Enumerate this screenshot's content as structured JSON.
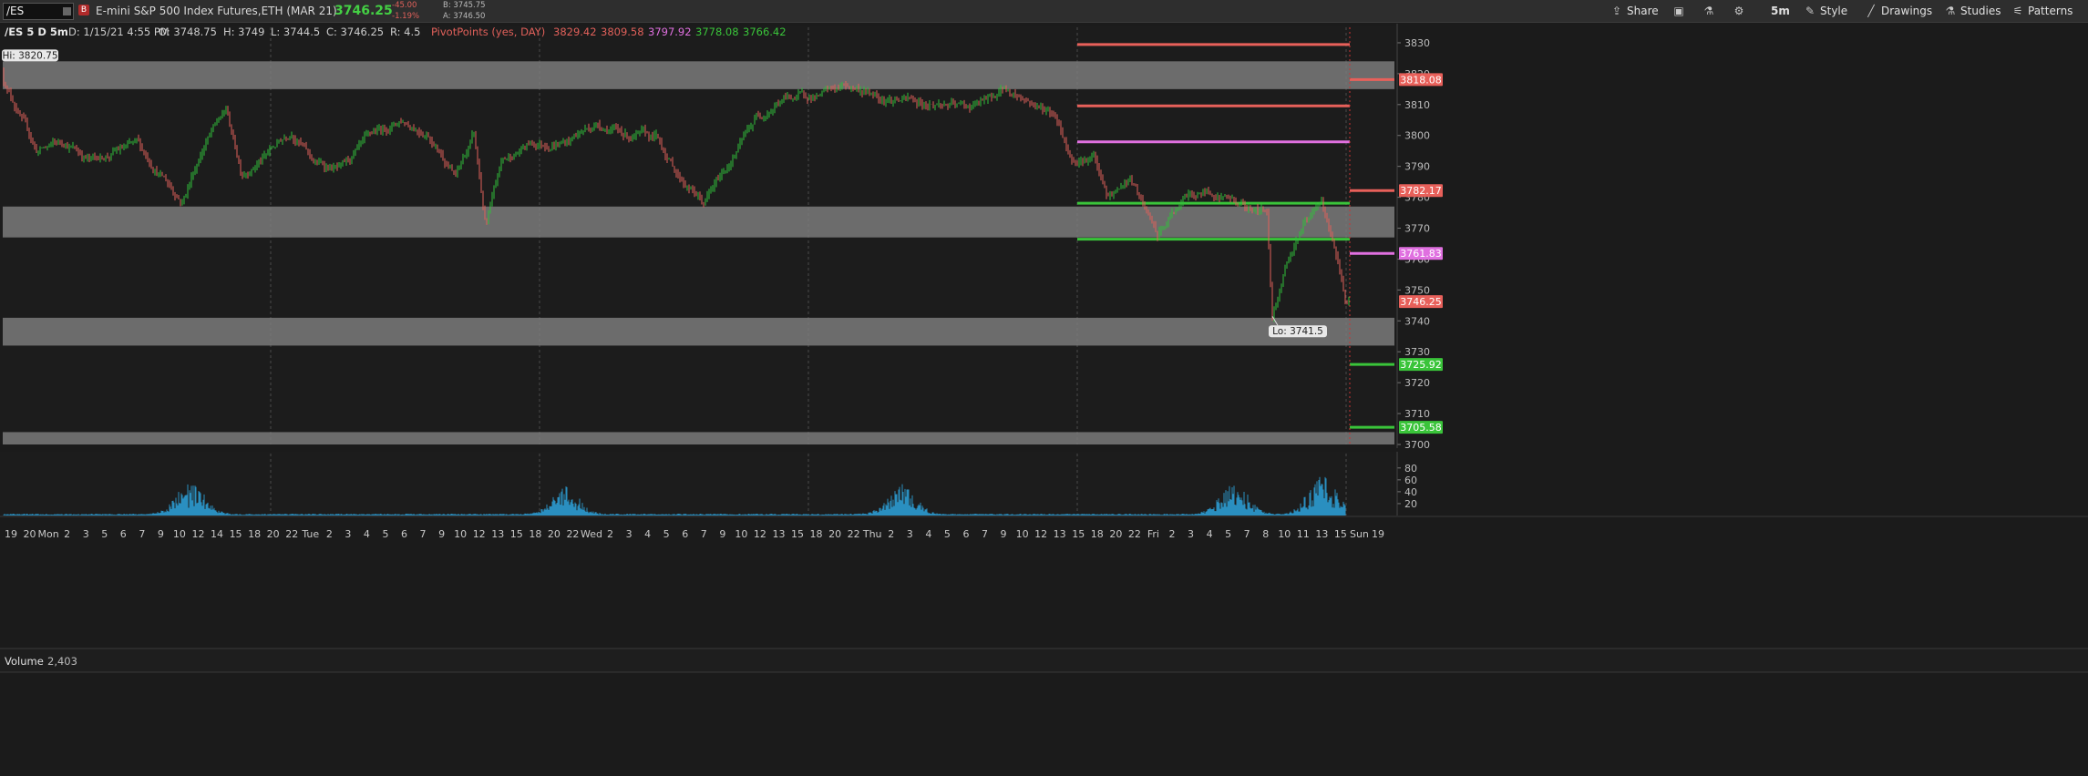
{
  "toolbar": {
    "symbol": "/ES",
    "link_badge": "B",
    "description": "E-mini S&P 500 Index Futures,ETH (MAR 21)",
    "last_price": "3746.25",
    "net_change": "-45.00",
    "pct_change": "-1.19%",
    "bid": "B: 3745.75",
    "ask": "A: 3746.50",
    "share_label": "Share",
    "timeframe_label": "5m",
    "style_label": "Style",
    "drawings_label": "Drawings",
    "studies_label": "Studies",
    "patterns_label": "Patterns"
  },
  "info": {
    "chart_id": "/ES 5 D 5m",
    "date": "D: 1/15/21 4:55 PM",
    "open": "O: 3748.75",
    "high": "H: 3749",
    "low": "L: 3744.5",
    "close": "C: 3746.25",
    "range": "R: 4.5",
    "study_name": "PivotPoints (yes, DAY)",
    "pivot_values": [
      "3829.42",
      "3809.58",
      "3797.92",
      "3778.08",
      "3766.42"
    ]
  },
  "volume_panel": {
    "label": "Volume",
    "value": "2,403"
  },
  "colors": {
    "background": "#1b1b1b",
    "up_candle": "#2fbf3a",
    "down_candle": "#e0605a",
    "resistance": "#e8605a",
    "pivot": "#e070e0",
    "support": "#3ac43a",
    "zone": "#7a7a7a",
    "volume": "#2a8fc0"
  },
  "chart_data": [
    {
      "type": "candlestick",
      "title": "/ES 5 D 5m",
      "y_range": [
        3700,
        3835
      ],
      "yticks": [
        3700,
        3710,
        3720,
        3730,
        3740,
        3750,
        3760,
        3770,
        3780,
        3790,
        3800,
        3810,
        3820,
        3830
      ],
      "price_path": [
        [
          0,
          3820.75
        ],
        [
          40,
          3795
        ],
        [
          70,
          3798
        ],
        [
          100,
          3792
        ],
        [
          150,
          3797
        ],
        [
          200,
          3779
        ],
        [
          225,
          3798
        ],
        [
          248,
          3808
        ],
        [
          265,
          3788
        ],
        [
          290,
          3793
        ],
        [
          320,
          3802
        ],
        [
          345,
          3791
        ],
        [
          375,
          3789
        ],
        [
          410,
          3800
        ],
        [
          440,
          3805
        ],
        [
          470,
          3801
        ],
        [
          500,
          3787
        ],
        [
          520,
          3800
        ],
        [
          533,
          3770
        ],
        [
          550,
          3791
        ],
        [
          580,
          3797
        ],
        [
          620,
          3798
        ],
        [
          655,
          3804
        ],
        [
          690,
          3800
        ],
        [
          720,
          3799
        ],
        [
          745,
          3787
        ],
        [
          772,
          3778
        ],
        [
          800,
          3791
        ],
        [
          830,
          3806
        ],
        [
          860,
          3812
        ],
        [
          900,
          3813
        ],
        [
          930,
          3816
        ],
        [
          965,
          3813
        ],
        [
          1000,
          3811
        ],
        [
          1035,
          3810
        ],
        [
          1060,
          3809
        ],
        [
          1090,
          3812
        ],
        [
          1100,
          3815
        ],
        [
          1130,
          3811
        ],
        [
          1160,
          3806
        ],
        [
          1175,
          3793
        ],
        [
          1200,
          3793
        ],
        [
          1215,
          3779
        ],
        [
          1240,
          3786
        ],
        [
          1270,
          3767
        ],
        [
          1300,
          3780
        ],
        [
          1330,
          3782
        ],
        [
          1360,
          3778
        ],
        [
          1390,
          3775
        ],
        [
          1396,
          3741.5
        ],
        [
          1410,
          3758
        ],
        [
          1430,
          3772
        ],
        [
          1450,
          3777
        ],
        [
          1468,
          3759
        ],
        [
          1477,
          3746.25
        ]
      ],
      "high_label": "Hi: 3820.75",
      "low_label": "Lo: 3741.5",
      "pivot_levels": [
        {
          "name": "R2",
          "value": 3829.42,
          "color": "#e8605a"
        },
        {
          "name": "R1",
          "value": 3809.58,
          "color": "#e8605a"
        },
        {
          "name": "PP",
          "value": 3797.92,
          "color": "#e070e0"
        },
        {
          "name": "S1",
          "value": 3778.08,
          "color": "#3ac43a"
        },
        {
          "name": "S2",
          "value": 3766.42,
          "color": "#3ac43a"
        }
      ],
      "right_price_tags": [
        {
          "label": "3818.08",
          "value": 3818.08,
          "color": "#e8605a"
        },
        {
          "label": "3782.17",
          "value": 3782.17,
          "color": "#e8605a"
        },
        {
          "label": "3761.83",
          "value": 3761.83,
          "color": "#e070e0"
        },
        {
          "label": "3746.25",
          "value": 3746.25,
          "color": "#e8605a"
        },
        {
          "label": "3725.92",
          "value": 3725.92,
          "color": "#3ac43a"
        },
        {
          "label": "3705.58",
          "value": 3705.58,
          "color": "#3ac43a"
        }
      ],
      "zones": [
        [
          3815,
          3824
        ],
        [
          3767,
          3777
        ],
        [
          3732,
          3741
        ],
        [
          3700,
          3704
        ]
      ],
      "x_axis": {
        "tick_labels": [
          "19",
          "20",
          "Mon",
          "2",
          "3",
          "5",
          "6",
          "7",
          "9",
          "10",
          "12",
          "14",
          "15",
          "18",
          "20",
          "22",
          "Tue",
          "2",
          "3",
          "4",
          "5",
          "6",
          "7",
          "9",
          "10",
          "12",
          "13",
          "15",
          "18",
          "20",
          "22",
          "Wed",
          "2",
          "3",
          "4",
          "5",
          "6",
          "7",
          "9",
          "10",
          "12",
          "13",
          "15",
          "18",
          "20",
          "22",
          "Thu",
          "2",
          "3",
          "4",
          "5",
          "6",
          "7",
          "9",
          "10",
          "12",
          "13",
          "15",
          "18",
          "20",
          "22",
          "Fri",
          "2",
          "3",
          "4",
          "5",
          "7",
          "8",
          "10",
          "11",
          "13",
          "15",
          "Sun",
          "19"
        ]
      }
    },
    {
      "type": "bar",
      "title": "Volume",
      "y_range": [
        0,
        95
      ],
      "yticks": [
        20,
        40,
        60,
        80
      ],
      "bursts": [
        {
          "center": 290,
          "spread": 120,
          "peak": 48
        },
        {
          "center": 860,
          "spread": 120,
          "peak": 42
        },
        {
          "center": 1375,
          "spread": 120,
          "peak": 44
        },
        {
          "center": 1880,
          "spread": 120,
          "peak": 48
        },
        {
          "center": 2015,
          "spread": 120,
          "peak": 58
        }
      ],
      "max_value": 96
    }
  ]
}
